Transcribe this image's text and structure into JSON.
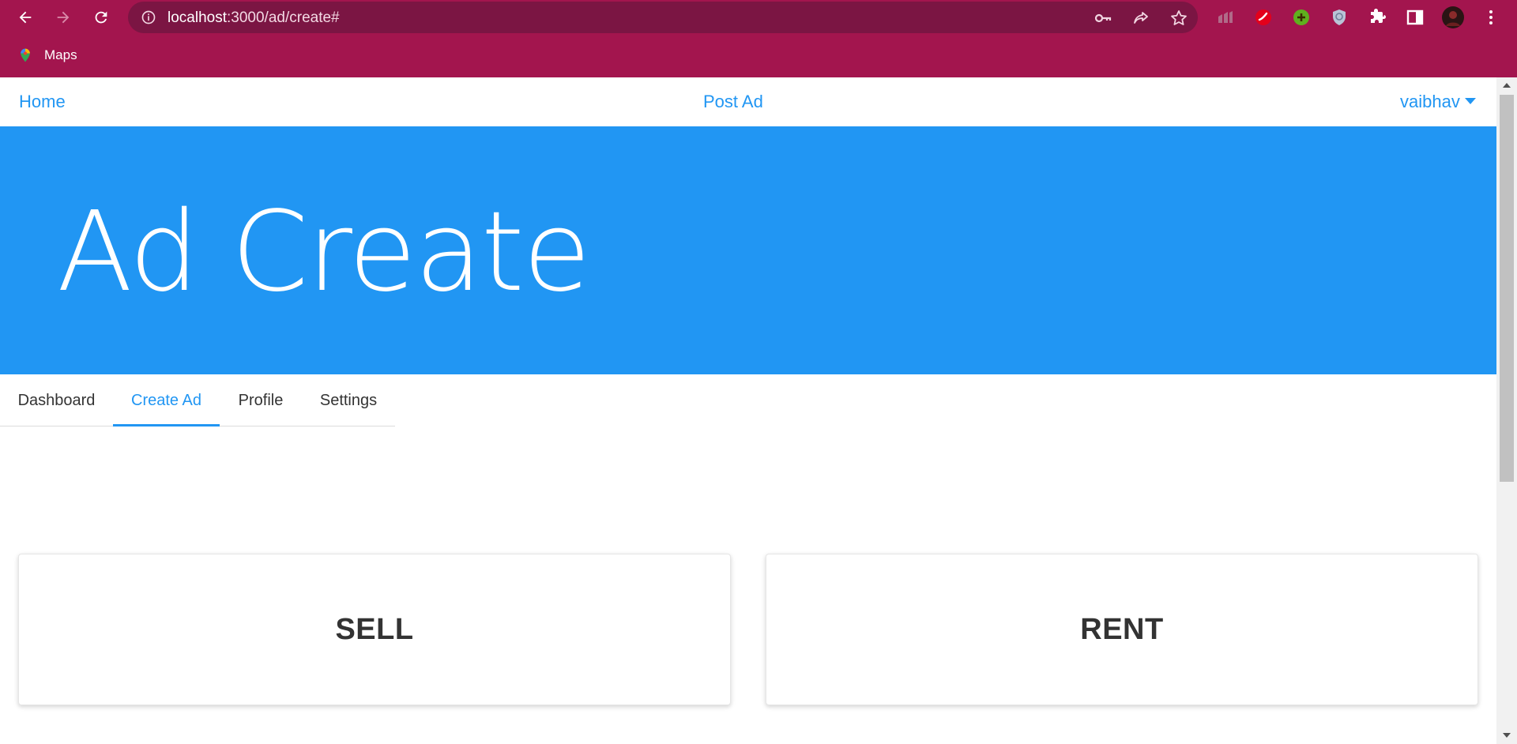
{
  "browser": {
    "url_host": "localhost",
    "url_rest": ":3000/ad/create#",
    "bookmarks": [
      {
        "label": "Maps"
      }
    ],
    "colors": {
      "frame": "#a3154e",
      "omnibox": "#7b1543"
    }
  },
  "topnav": {
    "home": "Home",
    "post_ad": "Post Ad",
    "user": "vaibhav"
  },
  "hero": {
    "title": "Ad Create",
    "background": "#2196f3"
  },
  "tabs": [
    {
      "label": "Dashboard",
      "active": false
    },
    {
      "label": "Create Ad",
      "active": true
    },
    {
      "label": "Profile",
      "active": false
    },
    {
      "label": "Settings",
      "active": false
    }
  ],
  "cards": [
    {
      "label": "SELL"
    },
    {
      "label": "RENT"
    }
  ]
}
